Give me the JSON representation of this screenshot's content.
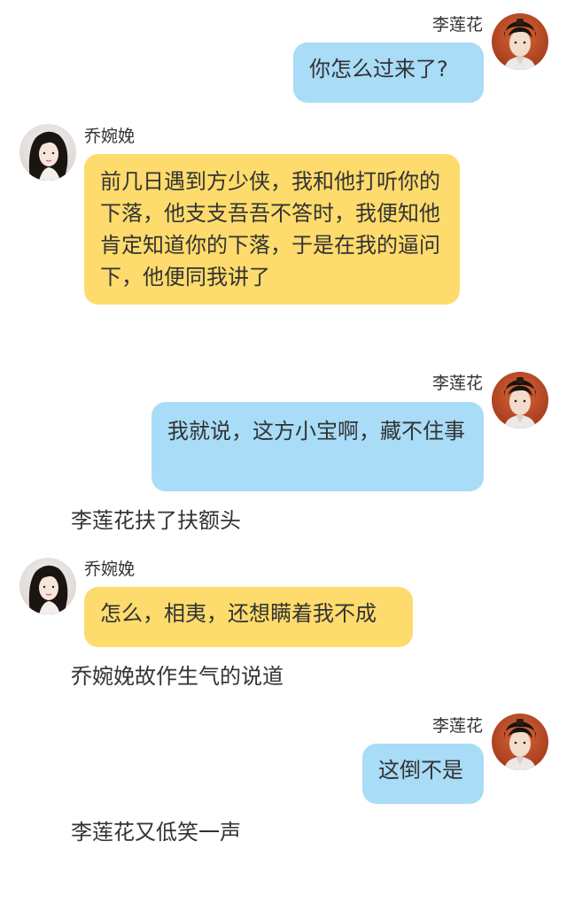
{
  "characters": {
    "right": {
      "name": "李莲花",
      "avatar_icon": "man-portrait-avatar-icon"
    },
    "left": {
      "name": "乔婉娩",
      "avatar_icon": "woman-portrait-avatar-icon"
    }
  },
  "colors": {
    "right_bubble": "#a8dcf7",
    "left_bubble": "#fddb6c",
    "text": "#333333",
    "background": "#ffffff"
  },
  "messages": [
    {
      "side": "right",
      "name": "李莲花",
      "text": "你怎么过来了?"
    },
    {
      "side": "left",
      "name": "乔婉娩",
      "text": "前几日遇到方少侠，我和他打听你的下落，他支支吾吾不答时，我便知他肯定知道你的下落，于是在我的逼问下，他便同我讲了"
    },
    {
      "side": "right",
      "name": "李莲花",
      "text": "我就说，这方小宝啊，藏不住事"
    },
    {
      "narration": "李莲花扶了扶额头"
    },
    {
      "side": "left",
      "name": "乔婉娩",
      "text": "怎么，相夷，还想瞒着我不成"
    },
    {
      "narration": "乔婉娩故作生气的说道"
    },
    {
      "side": "right",
      "name": "李莲花",
      "text": "这倒不是"
    },
    {
      "narration": "李莲花又低笑一声"
    }
  ]
}
